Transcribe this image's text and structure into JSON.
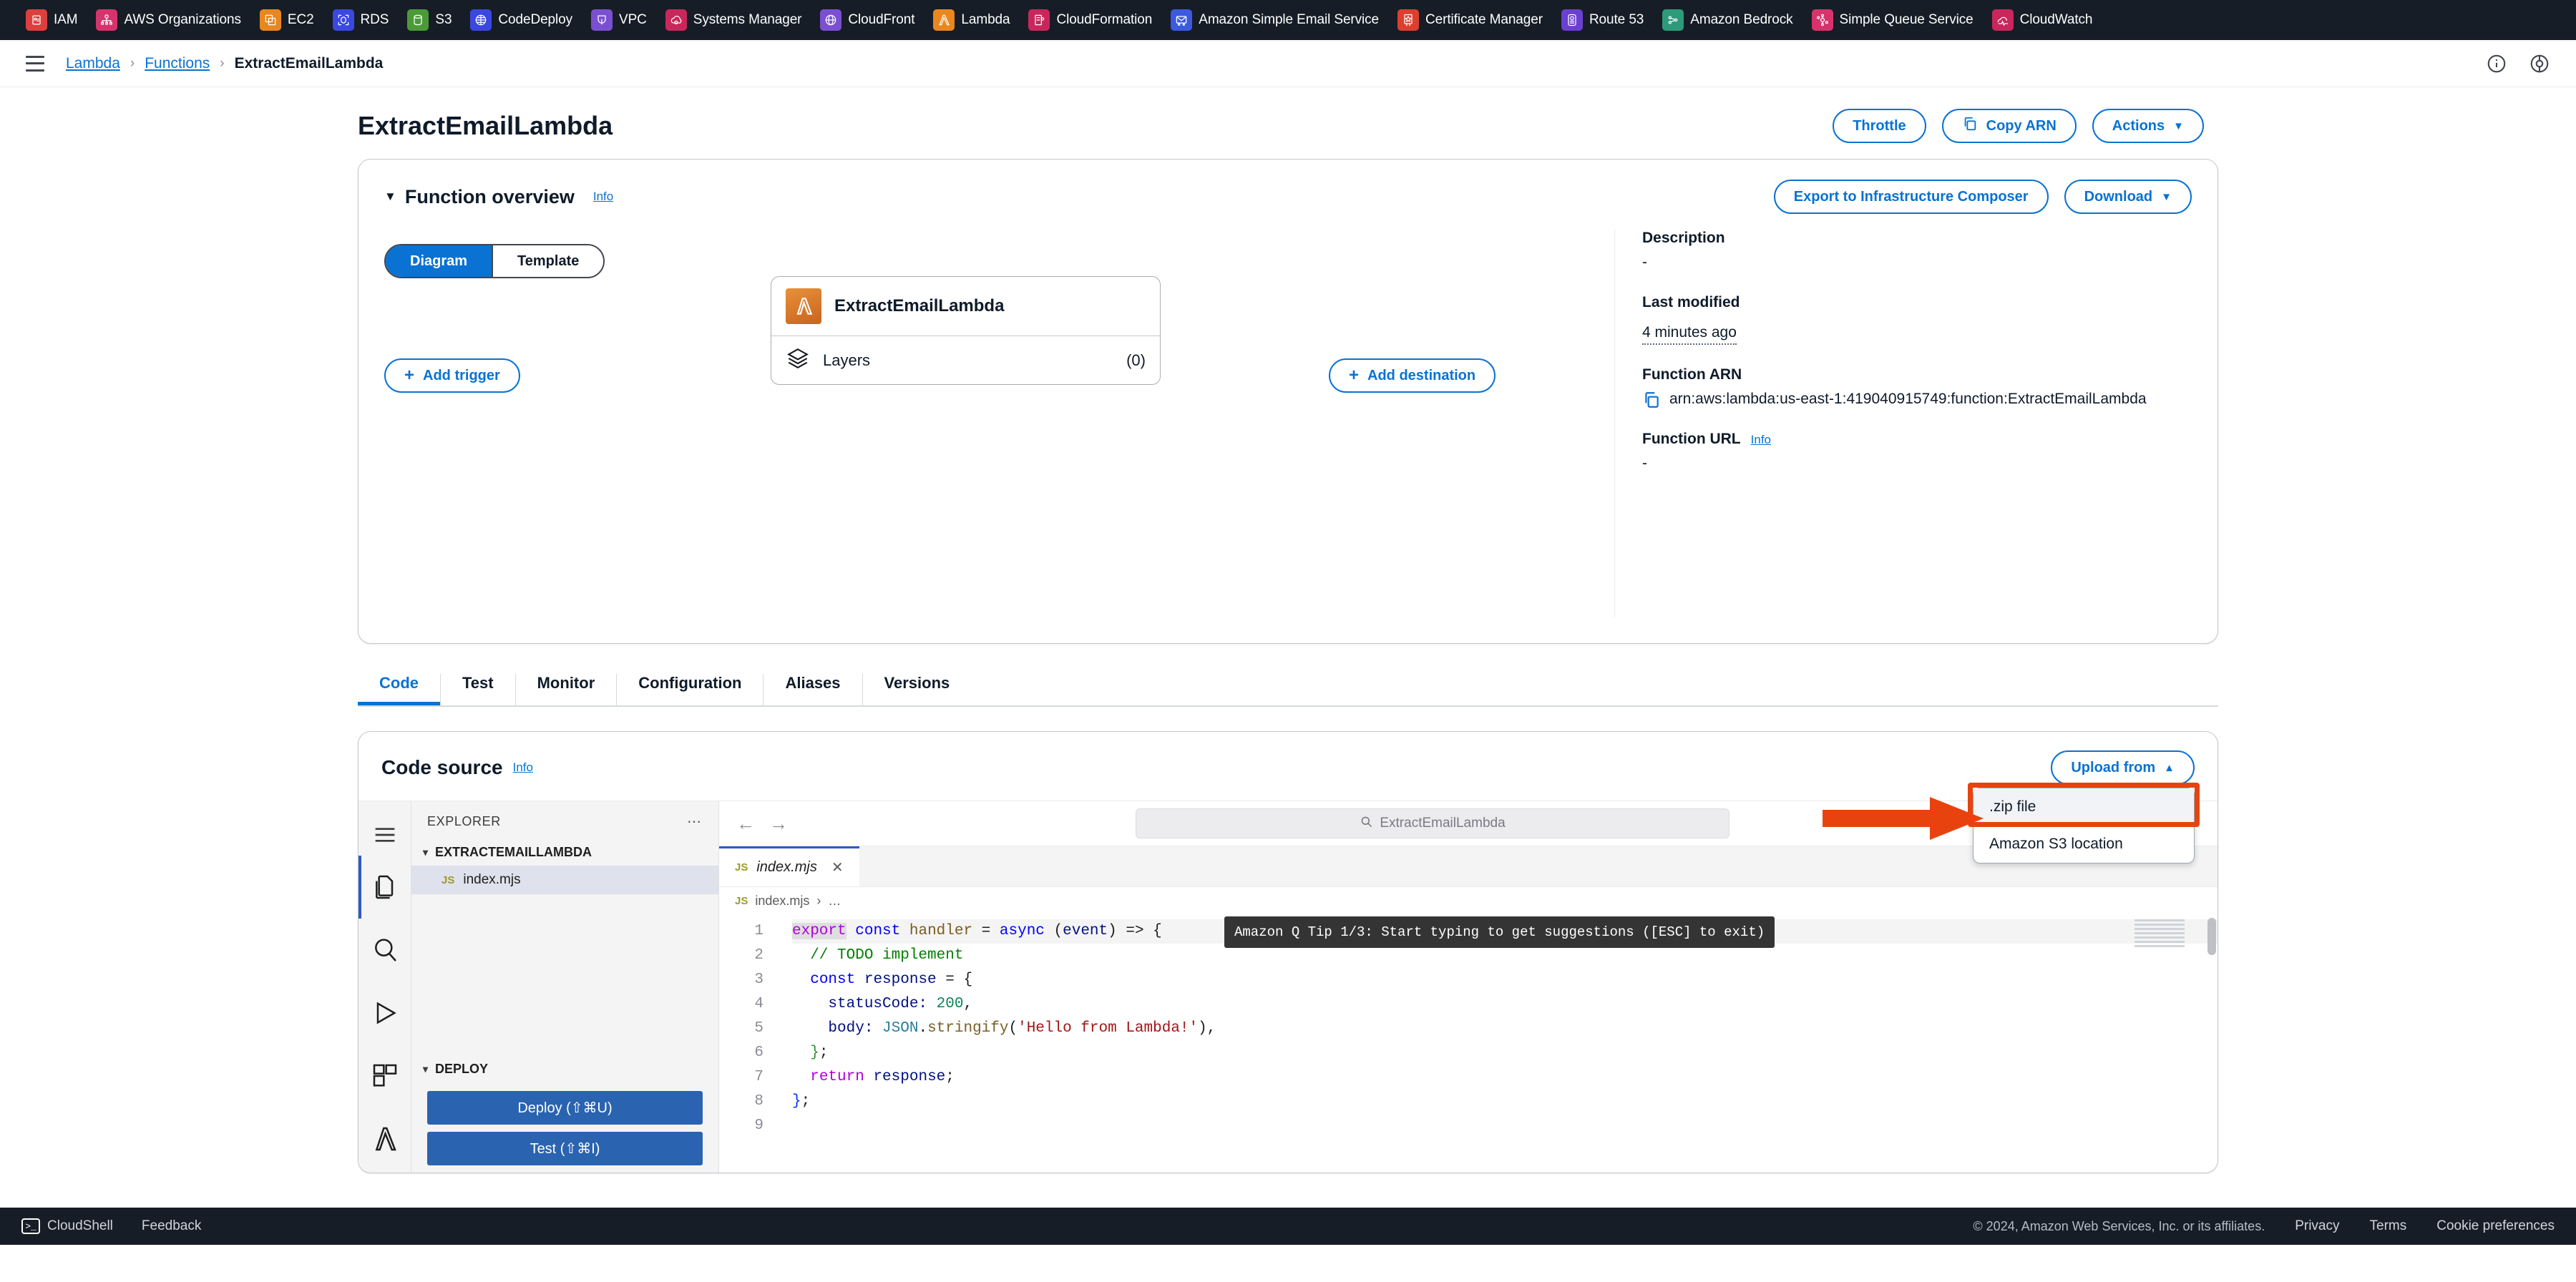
{
  "bookmarks": [
    {
      "label": "IAM",
      "icon": "iam-icon",
      "color": "#dd3f3f"
    },
    {
      "label": "AWS Organizations",
      "icon": "organizations-icon",
      "color": "#d6336c"
    },
    {
      "label": "EC2",
      "icon": "ec2-icon",
      "color": "#e8871f"
    },
    {
      "label": "RDS",
      "icon": "rds-icon",
      "color": "#3b48e0"
    },
    {
      "label": "S3",
      "icon": "s3-icon",
      "color": "#4a9b38"
    },
    {
      "label": "CodeDeploy",
      "icon": "codedeploy-icon",
      "color": "#3b48e0"
    },
    {
      "label": "VPC",
      "icon": "vpc-icon",
      "color": "#7b4fd1"
    },
    {
      "label": "Systems Manager",
      "icon": "systems-manager-icon",
      "color": "#c9275b"
    },
    {
      "label": "CloudFront",
      "icon": "cloudfront-icon",
      "color": "#7b4fd1"
    },
    {
      "label": "Lambda",
      "icon": "lambda-icon",
      "color": "#e8871f"
    },
    {
      "label": "CloudFormation",
      "icon": "cloudformation-icon",
      "color": "#c9275b"
    },
    {
      "label": "Amazon Simple Email Service",
      "icon": "ses-icon",
      "color": "#3b5ae0"
    },
    {
      "label": "Certificate Manager",
      "icon": "certificate-manager-icon",
      "color": "#dd3f2f"
    },
    {
      "label": "Route 53",
      "icon": "route53-icon",
      "color": "#6b3fd1"
    },
    {
      "label": "Amazon Bedrock",
      "icon": "bedrock-icon",
      "color": "#2d9b7a"
    },
    {
      "label": "Simple Queue Service",
      "icon": "sqs-icon",
      "color": "#d6336c"
    },
    {
      "label": "CloudWatch",
      "icon": "cloudwatch-icon",
      "color": "#c9275b"
    }
  ],
  "breadcrumb": {
    "service": "Lambda",
    "section": "Functions",
    "current": "ExtractEmailLambda",
    "separator": "›"
  },
  "page": {
    "title": "ExtractEmailLambda",
    "actions": {
      "throttle": "Throttle",
      "copy_arn": "Copy ARN",
      "actions": "Actions",
      "caret": "▼"
    }
  },
  "overview": {
    "heading": "Function overview",
    "info": "Info",
    "collapse_caret": "▼",
    "export_button": "Export to Infrastructure Composer",
    "download_button": "Download",
    "download_caret": "▼",
    "view_toggle": {
      "diagram": "Diagram",
      "template": "Template",
      "selected": "Diagram"
    },
    "node": {
      "name": "ExtractEmailLambda",
      "layers_label": "Layers",
      "layers_count": "(0)"
    },
    "add_trigger": "Add trigger",
    "add_destination": "Add destination",
    "plus": "+",
    "details": [
      {
        "label": "Description",
        "value": "-"
      },
      {
        "label": "Last modified",
        "value": "4 minutes ago"
      },
      {
        "label": "Function ARN",
        "value": "arn:aws:lambda:us-east-1:419040915749:function:ExtractEmailLambda"
      },
      {
        "label": "Function URL",
        "value": "-",
        "info": "Info"
      }
    ]
  },
  "tabs": [
    {
      "label": "Code",
      "active": true
    },
    {
      "label": "Test",
      "active": false
    },
    {
      "label": "Monitor",
      "active": false
    },
    {
      "label": "Configuration",
      "active": false
    },
    {
      "label": "Aliases",
      "active": false
    },
    {
      "label": "Versions",
      "active": false
    }
  ],
  "code_source": {
    "title": "Code source",
    "info": "Info",
    "upload_button": "Upload from",
    "upload_caret": "▲",
    "dropdown": {
      "items": [
        {
          "label": ".zip file",
          "highlighted": true
        },
        {
          "label": "Amazon S3 location",
          "highlighted": false
        }
      ],
      "highlight_color": "#e8430f"
    }
  },
  "ide": {
    "activity_icons": [
      "explorer-files-icon",
      "search-icon",
      "run-debug-icon",
      "extensions-icon",
      "lambda-icon"
    ],
    "explorer": {
      "title": "EXPLORER",
      "overflow": "…",
      "root": "EXTRACTEMAILLAMBDA",
      "chevron": "⌄",
      "files": [
        {
          "name": "index.mjs",
          "badge": "JS",
          "selected": true
        }
      ],
      "deploy_section": {
        "title": "DEPLOY",
        "deploy_button": "Deploy (⇧⌘U)",
        "test_button": "Test (⇧⌘I)"
      }
    },
    "editor": {
      "back_arrow": "←",
      "forward_arrow": "→",
      "search_placeholder": "ExtractEmailLambda",
      "search_icon": "search-icon",
      "tab": {
        "name": "index.mjs",
        "badge": "JS",
        "close": "✕"
      },
      "breadcrumb": {
        "badge": "JS",
        "file": "index.mjs",
        "sep": "›",
        "rest": "…"
      },
      "q_tip": "Amazon Q Tip 1/3: Start typing to get suggestions ([ESC] to exit)",
      "line_numbers": [
        "1",
        "2",
        "3",
        "4",
        "5",
        "6",
        "7",
        "8",
        "9"
      ],
      "code_lines": [
        [
          {
            "t": "export",
            "c": "t-kw"
          },
          {
            "t": " ",
            "c": "t-op"
          },
          {
            "t": "const",
            "c": "t-kw2"
          },
          {
            "t": " ",
            "c": "t-op"
          },
          {
            "t": "handler",
            "c": "t-var"
          },
          {
            "t": " = ",
            "c": "t-op"
          },
          {
            "t": "async",
            "c": "t-kw2"
          },
          {
            "t": " (",
            "c": "t-op"
          },
          {
            "t": "event",
            "c": "t-id"
          },
          {
            "t": ") => {",
            "c": "t-op"
          }
        ],
        [
          {
            "t": "  // TODO implement",
            "c": "t-cmt"
          }
        ],
        [
          {
            "t": "  ",
            "c": "t-op"
          },
          {
            "t": "const",
            "c": "t-kw2"
          },
          {
            "t": " ",
            "c": "t-op"
          },
          {
            "t": "response",
            "c": "t-id"
          },
          {
            "t": " = {",
            "c": "t-op"
          }
        ],
        [
          {
            "t": "    statusCode: ",
            "c": "t-id"
          },
          {
            "t": "200",
            "c": "t-num"
          },
          {
            "t": ",",
            "c": "t-op"
          }
        ],
        [
          {
            "t": "    body: ",
            "c": "t-id"
          },
          {
            "t": "JSON",
            "c": "t-cls"
          },
          {
            "t": ".",
            "c": "t-op"
          },
          {
            "t": "stringify",
            "c": "t-fn"
          },
          {
            "t": "(",
            "c": "t-op"
          },
          {
            "t": "'Hello from Lambda!'",
            "c": "t-str"
          },
          {
            "t": "),",
            "c": "t-op"
          }
        ],
        [
          {
            "t": "  ",
            "c": "t-op"
          },
          {
            "t": "}",
            "c": "t-brc2"
          },
          {
            "t": ";",
            "c": "t-op"
          }
        ],
        [
          {
            "t": "  ",
            "c": "t-op"
          },
          {
            "t": "return",
            "c": "t-kw"
          },
          {
            "t": " ",
            "c": "t-op"
          },
          {
            "t": "response",
            "c": "t-id"
          },
          {
            "t": ";",
            "c": "t-op"
          }
        ],
        [
          {
            "t": "}",
            "c": "t-brc"
          },
          {
            "t": ";",
            "c": "t-op"
          }
        ],
        []
      ]
    }
  },
  "footer": {
    "cloudshell": "CloudShell",
    "feedback": "Feedback",
    "copyright": "© 2024, Amazon Web Services, Inc. or its affiliates.",
    "privacy": "Privacy",
    "terms": "Terms",
    "cookie": "Cookie preferences"
  }
}
